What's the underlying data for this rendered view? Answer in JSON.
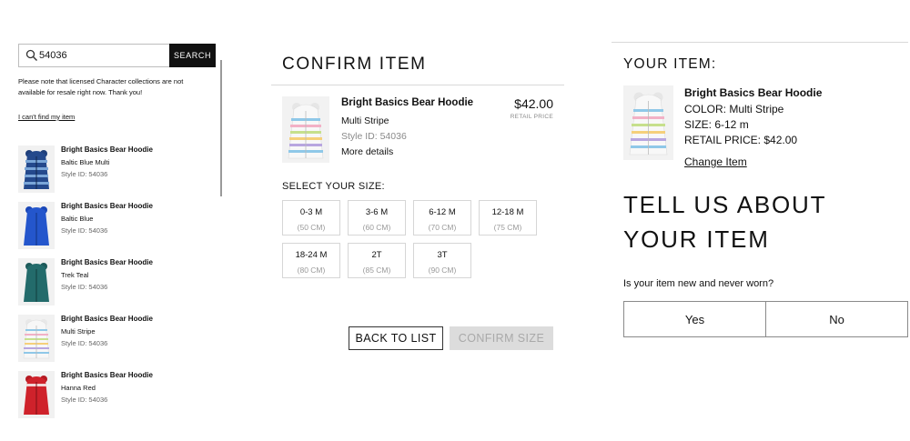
{
  "search": {
    "value": "54036",
    "button_label": "SEARCH",
    "notice": "Please note that licensed Character collections are not available for resale right now. Thank you!",
    "cant_find_label": "I can't find my item"
  },
  "results": [
    {
      "name": "Bright Basics Bear Hoodie",
      "color": "Baltic Blue Multi",
      "style": "Style ID: 54036",
      "image": "baltic-blue-multi-hoodie-image"
    },
    {
      "name": "Bright Basics Bear Hoodie",
      "color": "Baltic Blue",
      "style": "Style ID: 54036",
      "image": "baltic-blue-hoodie-image"
    },
    {
      "name": "Bright Basics Bear Hoodie",
      "color": "Trek Teal",
      "style": "Style ID: 54036",
      "image": "trek-teal-hoodie-image"
    },
    {
      "name": "Bright Basics Bear Hoodie",
      "color": "Multi Stripe",
      "style": "Style ID: 54036",
      "image": "multi-stripe-hoodie-image"
    },
    {
      "name": "Bright Basics Bear Hoodie",
      "color": "Hanna Red",
      "style": "Style ID: 54036",
      "image": "hanna-red-hoodie-image"
    }
  ],
  "confirm": {
    "title": "CONFIRM ITEM",
    "item_name": "Bright Basics Bear Hoodie",
    "item_color": "Multi Stripe",
    "item_style": "Style ID: 54036",
    "more_details": "More details",
    "price": "$42.00",
    "price_label": "RETAIL PRICE",
    "size_label": "SELECT YOUR SIZE:",
    "sizes": [
      {
        "name": "0-3 M",
        "cm": "(50 CM)"
      },
      {
        "name": "3-6 M",
        "cm": "(60 CM)"
      },
      {
        "name": "6-12 M",
        "cm": "(70 CM)"
      },
      {
        "name": "12-18 M",
        "cm": "(75 CM)"
      },
      {
        "name": "18-24 M",
        "cm": "(80 CM)"
      },
      {
        "name": "2T",
        "cm": "(85 CM)"
      },
      {
        "name": "3T",
        "cm": "(90 CM)"
      }
    ],
    "back_label": "BACK TO LIST",
    "confirm_size_label": "CONFIRM SIZE"
  },
  "your_item": {
    "title": "YOUR ITEM:",
    "name": "Bright Basics Bear Hoodie",
    "color": "COLOR: Multi Stripe",
    "size": "SIZE: 6-12 m",
    "price": "RETAIL PRICE: $42.00",
    "change_label": "Change Item"
  },
  "tell_us": {
    "title": "TELL US ABOUT YOUR ITEM",
    "question": "Is your item new and never worn?",
    "yes_label": "Yes",
    "no_label": "No"
  },
  "colors": {
    "text": "#111111",
    "muted": "#8a8a8a",
    "border": "#d6d6d6",
    "button_dark": "#111111",
    "button_disabled": "#dcdcdc"
  }
}
